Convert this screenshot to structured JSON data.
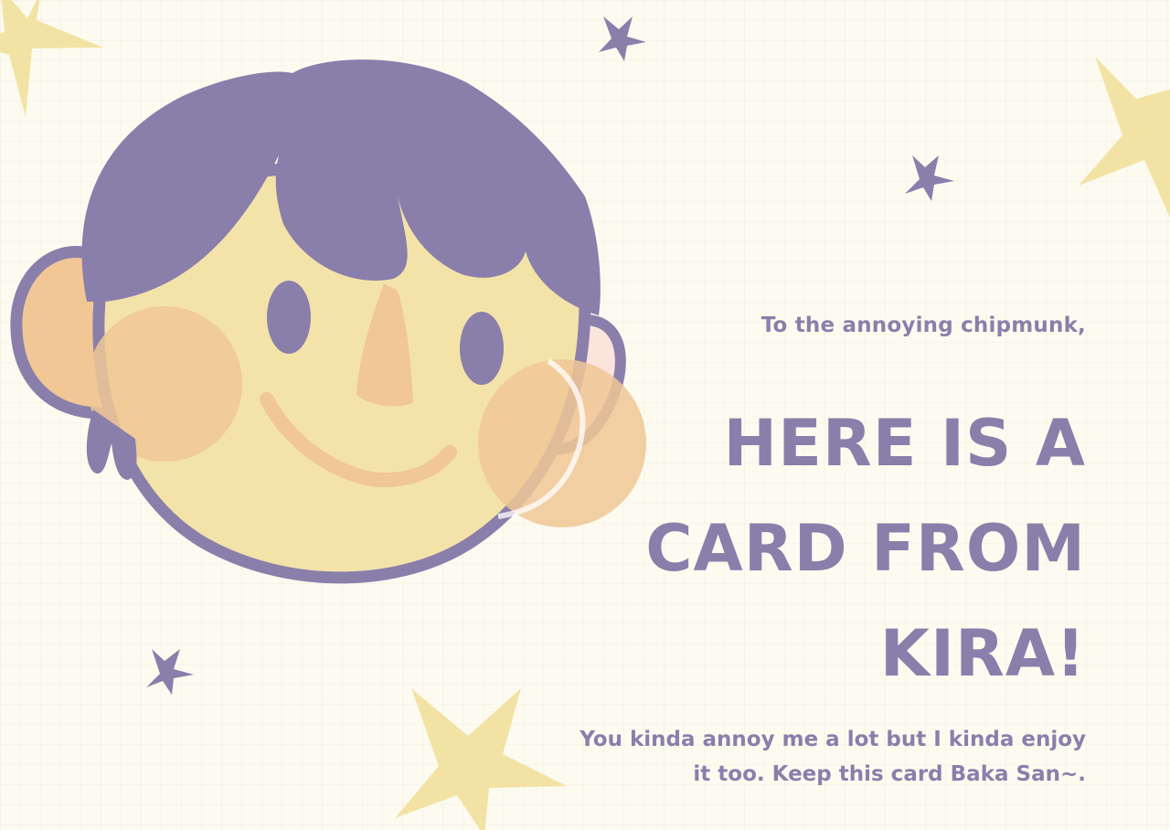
{
  "card": {
    "greeting": "To the annoying chipmunk,",
    "headline_lines": [
      "HERE IS A",
      "CARD FROM",
      "KIRA!"
    ],
    "message_lines": [
      "You kinda annoy me a lot but I kinda enjoy",
      "it too. Keep this card Baka San~."
    ]
  },
  "colors": {
    "background": "#fdfbf0",
    "accent_purple": "#8a7fab",
    "star_yellow": "#f2e3a5",
    "skin": "#f3e3a9",
    "cheek": "#f0c795"
  },
  "icons": [
    "smiling-face-illustration",
    "star-icon"
  ]
}
